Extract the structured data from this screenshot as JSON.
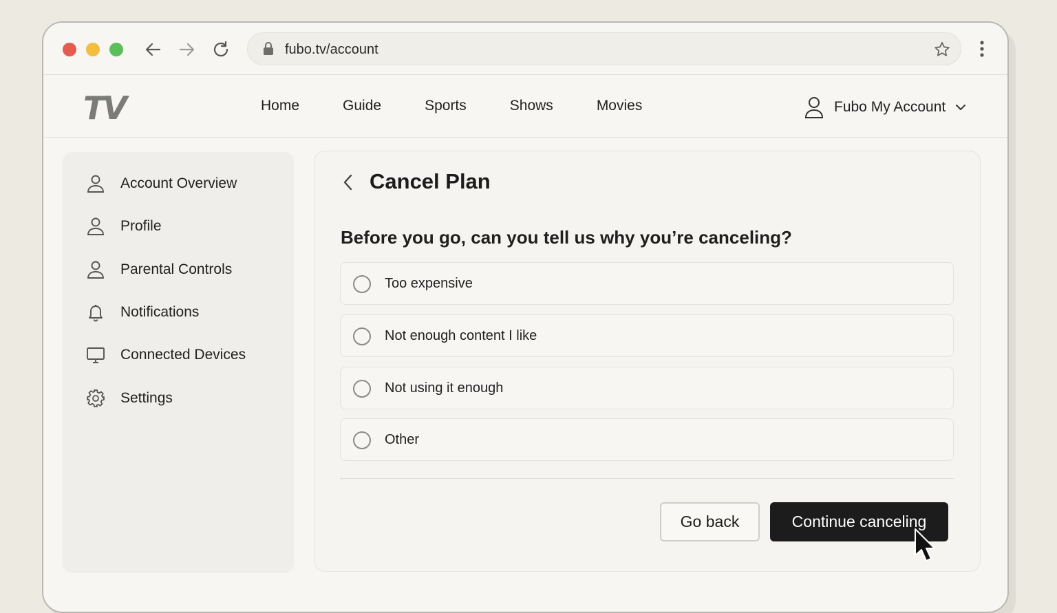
{
  "browser": {
    "url": "fubo.tv/account",
    "icons": [
      "back-arrow-icon",
      "forward-arrow-icon",
      "reload-icon",
      "lock-icon",
      "star-icon",
      "more-vertical-icon"
    ],
    "traffic_lights": {
      "red": "#e65b4f",
      "yellow": "#f2be42",
      "green": "#5cbf5a"
    }
  },
  "header": {
    "logo": "TV",
    "nav": [
      "Home",
      "Guide",
      "Sports",
      "Shows",
      "Movies"
    ],
    "account_label": "Fubo My Account"
  },
  "sidebar": {
    "items": [
      {
        "label": "Account Overview",
        "icon": "user-icon"
      },
      {
        "label": "Profile",
        "icon": "user-icon"
      },
      {
        "label": "Parental Controls",
        "icon": "user-icon"
      },
      {
        "label": "Notifications",
        "icon": "bell-icon"
      },
      {
        "label": "Connected Devices",
        "icon": "monitor-icon"
      },
      {
        "label": "Settings",
        "icon": "gear-icon"
      }
    ]
  },
  "main": {
    "title": "Cancel Plan",
    "question": "Before you go, can you tell us why you’re canceling?",
    "options": [
      {
        "label": "Too expensive",
        "selected": false
      },
      {
        "label": "Not enough content I like",
        "selected": false
      },
      {
        "label": "Not using it enough",
        "selected": false
      },
      {
        "label": "Other",
        "selected": false
      }
    ],
    "go_back_label": "Go back",
    "continue_label": "Continue canceling"
  },
  "colors": {
    "background": "#eceae1",
    "primary_button": "#1c1c1c",
    "text": "#1c1c1c"
  }
}
